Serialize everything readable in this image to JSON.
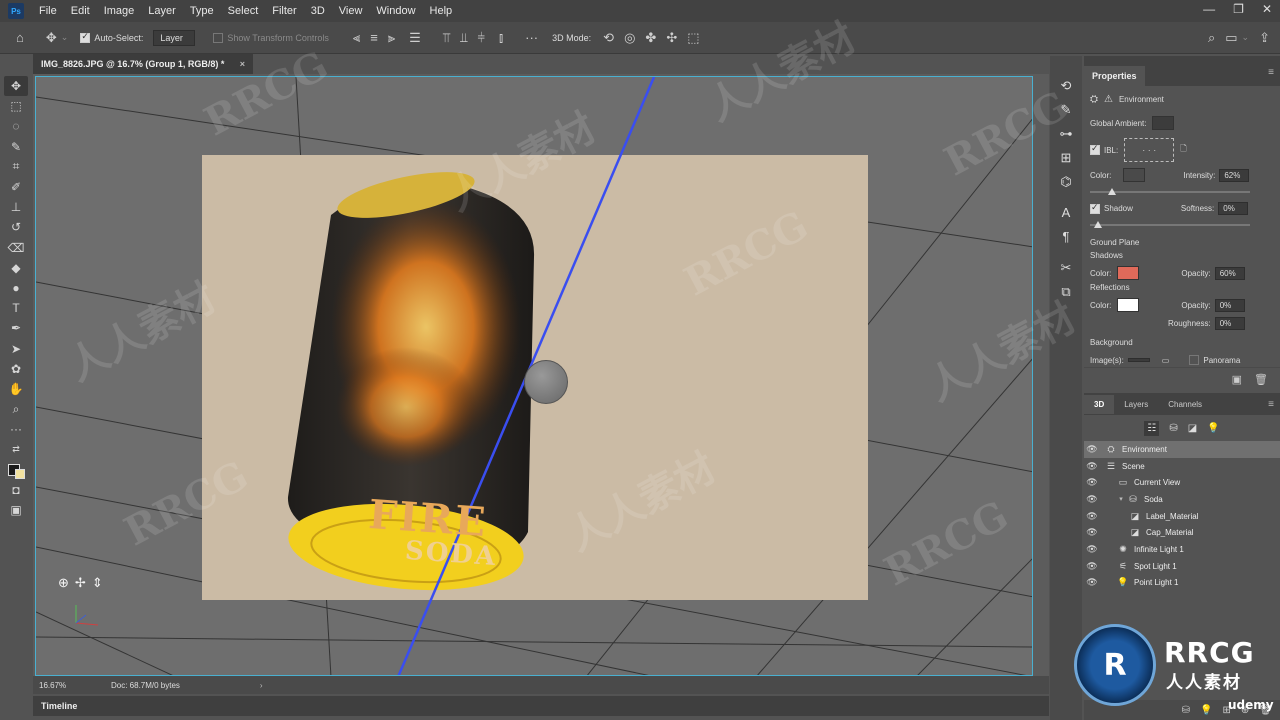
{
  "app": {
    "logo": "Ps"
  },
  "menu": [
    "File",
    "Edit",
    "Image",
    "Layer",
    "Type",
    "Select",
    "Filter",
    "3D",
    "View",
    "Window",
    "Help"
  ],
  "options": {
    "auto_select_label": "Auto-Select:",
    "auto_select_value": "Layer",
    "show_transform": "Show Transform Controls",
    "mode_label": "3D Mode:"
  },
  "document": {
    "tab_title": "IMG_8826.JPG @ 16.7% (Group 1, RGB/8) *",
    "can_title": "FIRE",
    "can_subtitle": "SODA"
  },
  "status": {
    "zoom": "16.67%",
    "doc_info": "Doc: 68.7M/0 bytes"
  },
  "timeline": {
    "label": "Timeline"
  },
  "properties": {
    "tab": "Properties",
    "section": "Environment",
    "global_ambient": "Global Ambient:",
    "ibl": "IBL:",
    "color_label": "Color:",
    "intensity_label": "Intensity:",
    "intensity_value": "62%",
    "shadow_label": "Shadow",
    "softness_label": "Softness:",
    "softness_value": "0%",
    "ground_plane": "Ground Plane",
    "shadows": "Shadows",
    "shadow_color_label": "Color:",
    "shadow_opacity_label": "Opacity:",
    "shadow_opacity_value": "60%",
    "reflections": "Reflections",
    "refl_color_label": "Color:",
    "refl_opacity_label": "Opacity:",
    "refl_opacity_value": "0%",
    "roughness_label": "Roughness:",
    "roughness_value": "0%",
    "background": "Background",
    "image_label": "Image(s):",
    "panorama_label": "Panorama",
    "colors": {
      "ambient": "#3c3c3c",
      "ibl_color": "#4a4a4a",
      "shadow_color": "#e06a5a",
      "refl_color": "#ffffff"
    }
  },
  "panel3d": {
    "tabs": [
      "3D",
      "Layers",
      "Channels"
    ],
    "layers": [
      {
        "name": "Environment",
        "icon": "environment-icon",
        "indent": 0
      },
      {
        "name": "Scene",
        "icon": "scene-icon",
        "indent": 0
      },
      {
        "name": "Current View",
        "icon": "camera-icon",
        "indent": 1
      },
      {
        "name": "Soda",
        "icon": "mesh-icon",
        "indent": 1
      },
      {
        "name": "Label_Material",
        "icon": "material-icon",
        "indent": 2
      },
      {
        "name": "Cap_Material",
        "icon": "material-icon",
        "indent": 2
      },
      {
        "name": "Infinite Light 1",
        "icon": "infinite-light-icon",
        "indent": 1
      },
      {
        "name": "Spot Light 1",
        "icon": "spot-light-icon",
        "indent": 1
      },
      {
        "name": "Point Light 1",
        "icon": "point-light-icon",
        "indent": 1
      }
    ]
  },
  "watermark": {
    "brand": "RRCG",
    "brand_cn": "人人素材",
    "platform": "udemy"
  }
}
